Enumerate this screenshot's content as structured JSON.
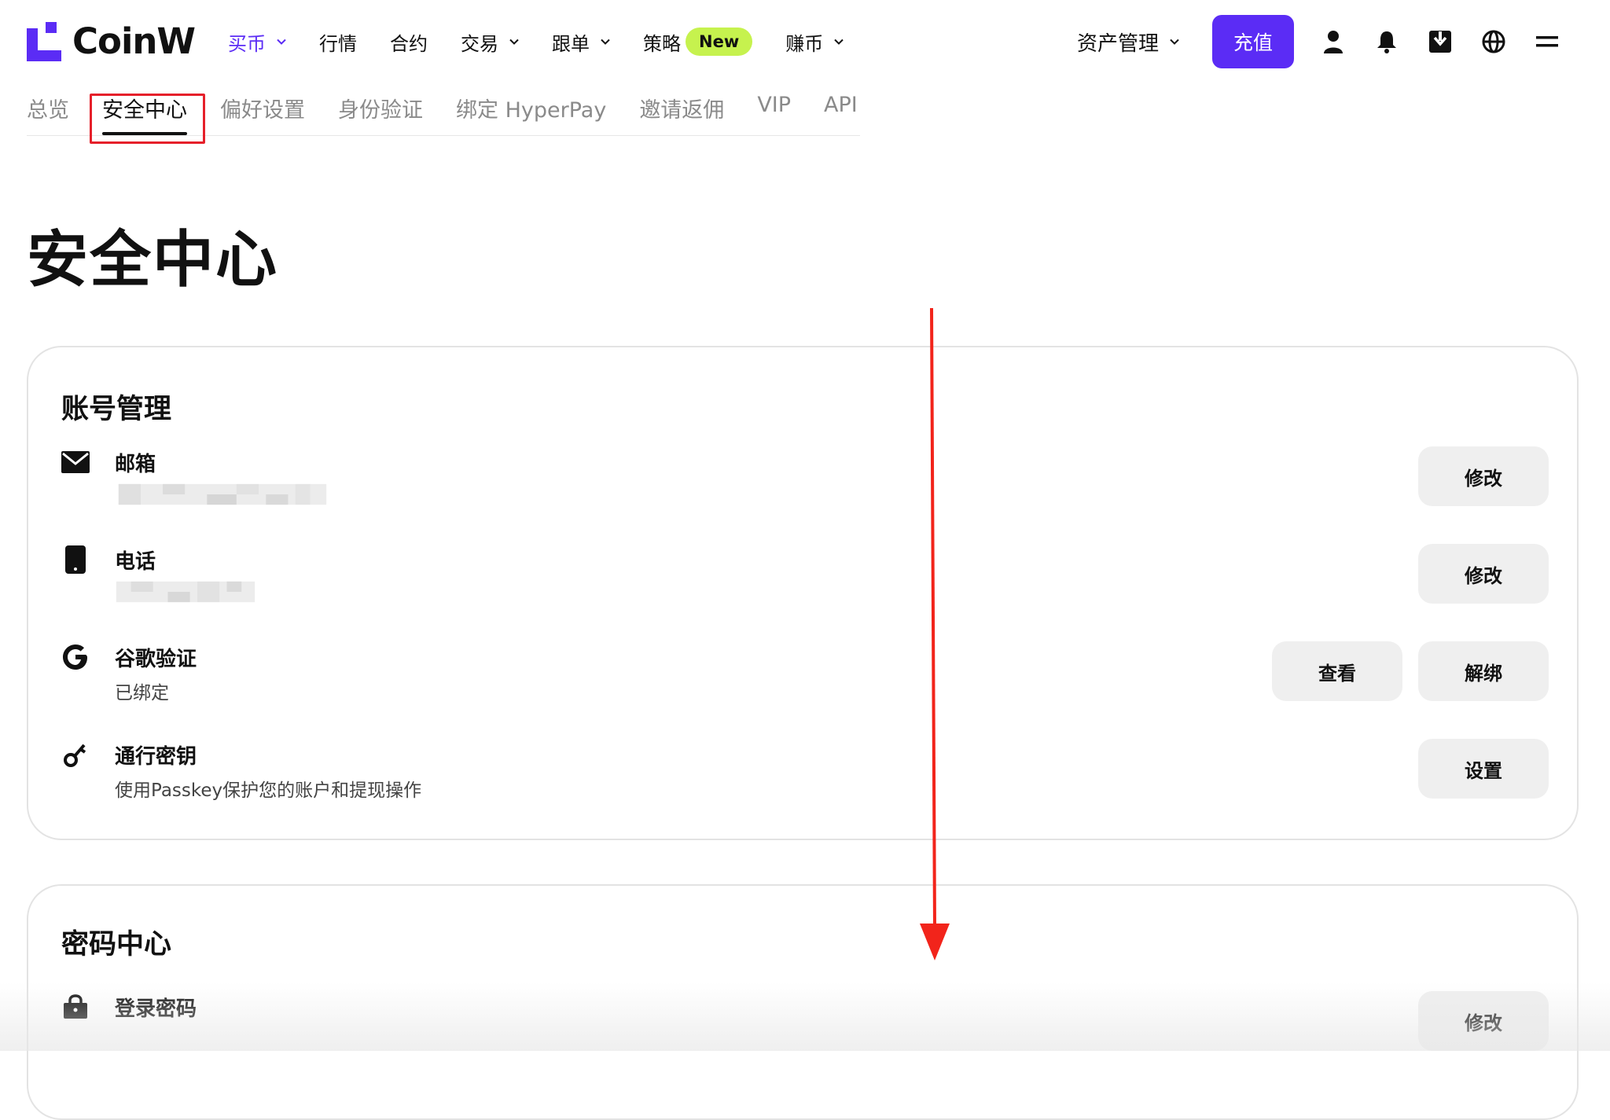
{
  "brand": {
    "name": "CoinW",
    "accent": "#5b2cf5",
    "badge_color": "#c6f24e",
    "highlight_color": "#e5202a"
  },
  "nav": {
    "items": [
      {
        "label": "买币",
        "active": true,
        "dropdown": true
      },
      {
        "label": "行情",
        "active": false,
        "dropdown": false
      },
      {
        "label": "合约",
        "active": false,
        "dropdown": false
      },
      {
        "label": "交易",
        "active": false,
        "dropdown": true
      },
      {
        "label": "跟单",
        "active": false,
        "dropdown": true
      },
      {
        "label": "策略",
        "active": false,
        "dropdown": false,
        "badge": "New"
      },
      {
        "label": "赚币",
        "active": false,
        "dropdown": true
      }
    ],
    "asset_menu": "资产管理",
    "deposit_label": "充值",
    "icons": [
      "user-icon",
      "bell-icon",
      "download-icon",
      "globe-icon",
      "menu-icon"
    ]
  },
  "tabs": [
    {
      "label": "总览",
      "active": false
    },
    {
      "label": "安全中心",
      "active": true
    },
    {
      "label": "偏好设置",
      "active": false
    },
    {
      "label": "身份验证",
      "active": false
    },
    {
      "label": "绑定 HyperPay",
      "active": false
    },
    {
      "label": "邀请返佣",
      "active": false
    },
    {
      "label": "VIP",
      "active": false
    },
    {
      "label": "API",
      "active": false
    }
  ],
  "page_title": "安全中心",
  "account_card": {
    "title": "账号管理",
    "rows": [
      {
        "icon": "mail-icon",
        "label": "邮箱",
        "sub": "",
        "masked": true,
        "buttons": [
          "修改"
        ]
      },
      {
        "icon": "phone-icon",
        "label": "电话",
        "sub": "",
        "masked": true,
        "buttons": [
          "修改"
        ]
      },
      {
        "icon": "google-icon",
        "label": "谷歌验证",
        "sub": "已绑定",
        "masked": false,
        "buttons": [
          "解绑",
          "查看"
        ]
      },
      {
        "icon": "key-icon",
        "label": "通行密钥",
        "sub": "使用Passkey保护您的账户和提现操作",
        "masked": false,
        "buttons": [
          "设置"
        ]
      }
    ]
  },
  "password_card": {
    "title": "密码中心",
    "rows": [
      {
        "icon": "lock-icon",
        "label": "登录密码",
        "buttons": [
          "修改"
        ]
      }
    ]
  }
}
